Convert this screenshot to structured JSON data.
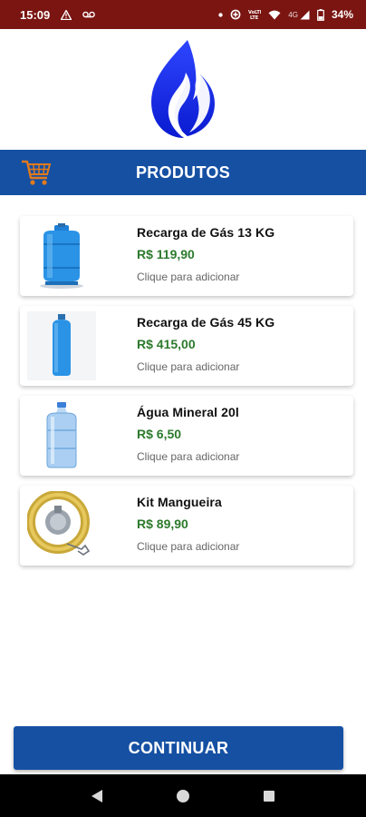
{
  "status_bar": {
    "time": "15:09",
    "network": "4G",
    "battery": "34%",
    "icons": [
      "warning-icon",
      "voicemail-icon",
      "dot-icon",
      "data-saver-icon",
      "volte-icon",
      "wifi-icon",
      "signal-icon",
      "battery-icon"
    ]
  },
  "header": {
    "title": "PRODUTOS",
    "cart_icon": "shopping-cart-icon",
    "colors": {
      "bar": "#1550a3",
      "cart": "#e07a1e"
    }
  },
  "products": [
    {
      "name": "Recarga de Gás 13 KG",
      "price": "R$ 119,90",
      "hint": "Clique para adicionar",
      "image": "gas-cylinder-13kg"
    },
    {
      "name": "Recarga de Gás 45 KG",
      "price": "R$ 415,00",
      "hint": "Clique para adicionar",
      "image": "gas-cylinder-45kg"
    },
    {
      "name": "Água Mineral 20l",
      "price": "R$ 6,50",
      "hint": "Clique para adicionar",
      "image": "water-jug"
    },
    {
      "name": "Kit Mangueira",
      "price": "R$ 89,90",
      "hint": "Clique para adicionar",
      "image": "hose-kit"
    }
  ],
  "continue_button": {
    "label": "CONTINUAR"
  },
  "colors": {
    "status_bar": "#7a1511",
    "price": "#2c7a2c",
    "button": "#1550a3"
  },
  "nav": [
    "back-icon",
    "home-icon",
    "recents-icon"
  ]
}
